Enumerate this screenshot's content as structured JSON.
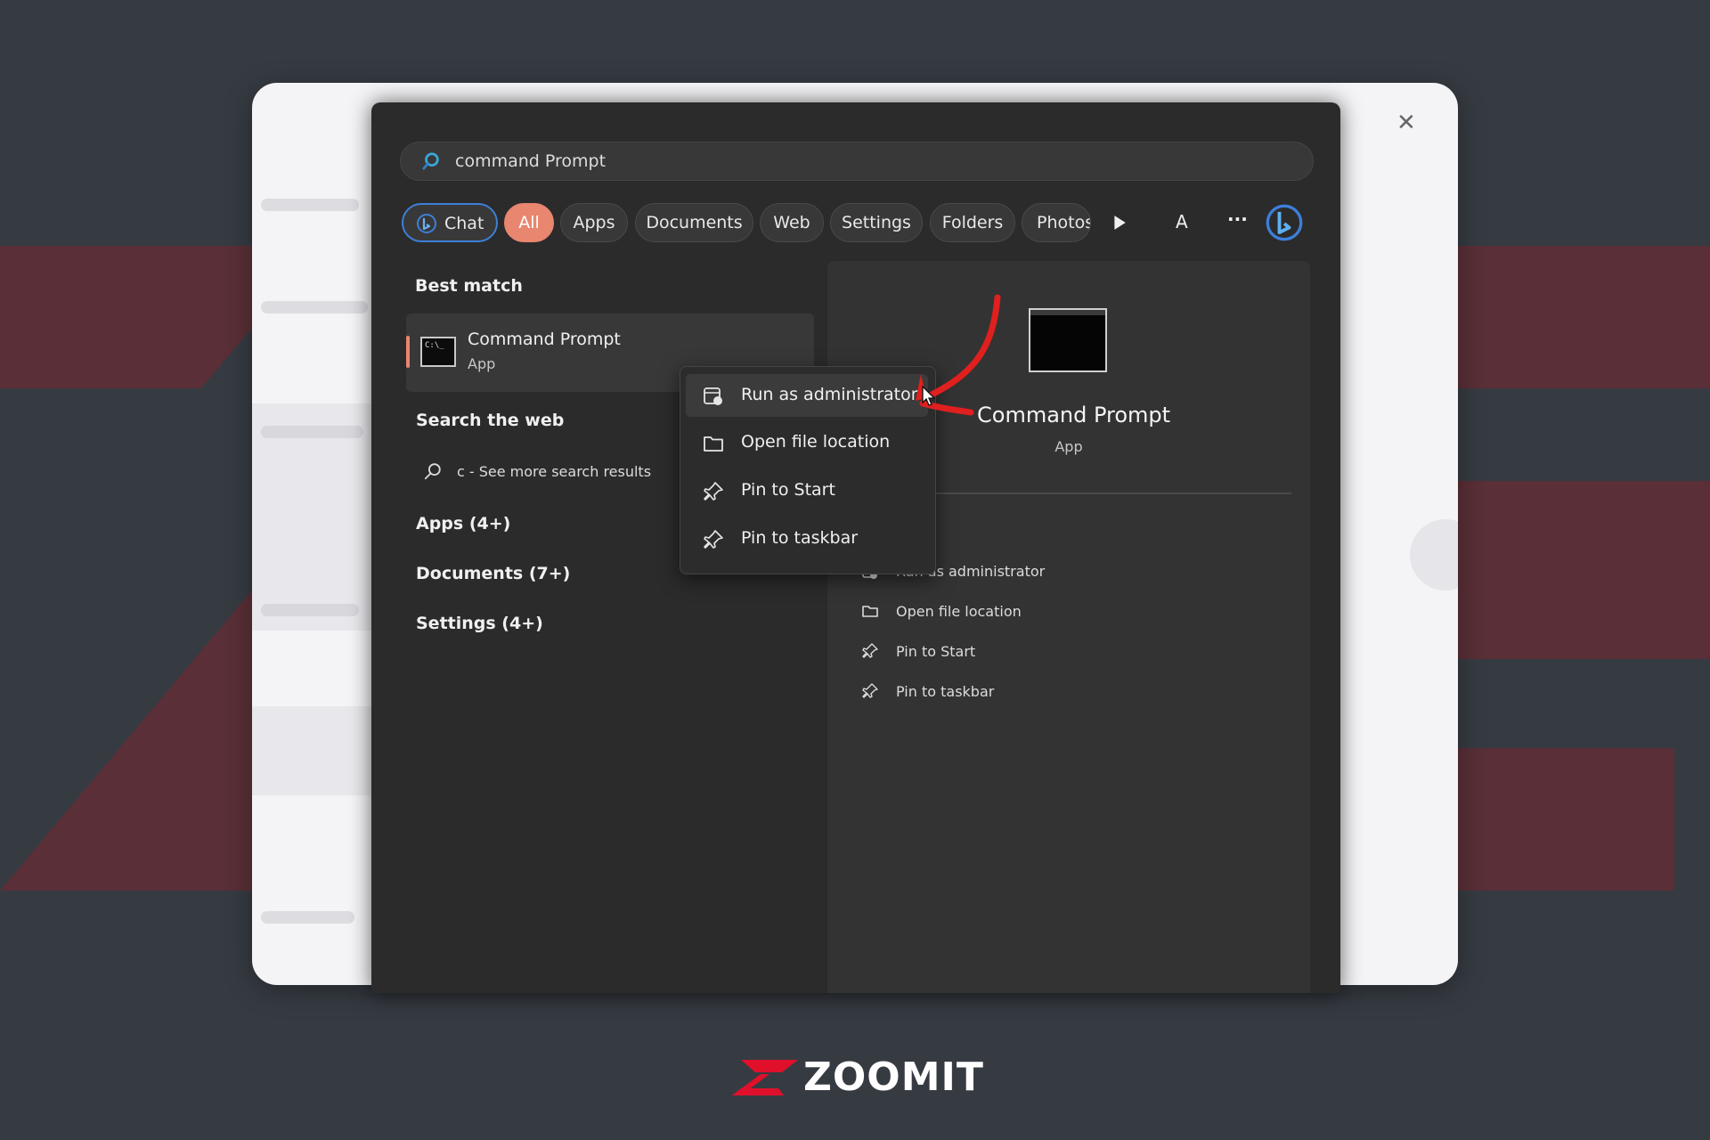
{
  "search": {
    "query": "command Prompt"
  },
  "filters": [
    {
      "label": "Chat",
      "active": false
    },
    {
      "label": "All",
      "active": true
    },
    {
      "label": "Apps"
    },
    {
      "label": "Documents"
    },
    {
      "label": "Web"
    },
    {
      "label": "Settings"
    },
    {
      "label": "Folders"
    },
    {
      "label": "Photos"
    }
  ],
  "account_initial": "A",
  "more_label": "···",
  "results": {
    "best_match_heading": "Best match",
    "best_match": {
      "title": "Command Prompt",
      "subtitle": "App",
      "icon_text": "C:\\_"
    },
    "search_web_heading": "Search the web",
    "search_web_item": "c - See more search results",
    "groups": [
      "Apps (4+)",
      "Documents (7+)",
      "Settings (4+)"
    ]
  },
  "context_menu": {
    "items": [
      "Run as administrator",
      "Open file location",
      "Pin to Start",
      "Pin to taskbar"
    ]
  },
  "details": {
    "title": "Command Prompt",
    "subtitle": "App",
    "actions": [
      "Run as administrator",
      "Open file location",
      "Pin to Start",
      "Pin to taskbar"
    ]
  },
  "brand": {
    "name": "ZOOMIT",
    "accent": "#e0102b"
  },
  "colors": {
    "accent_pill": "#e8866f",
    "annotation_arrow": "#e01f1f",
    "chat_ring": "#3d7fd8"
  }
}
